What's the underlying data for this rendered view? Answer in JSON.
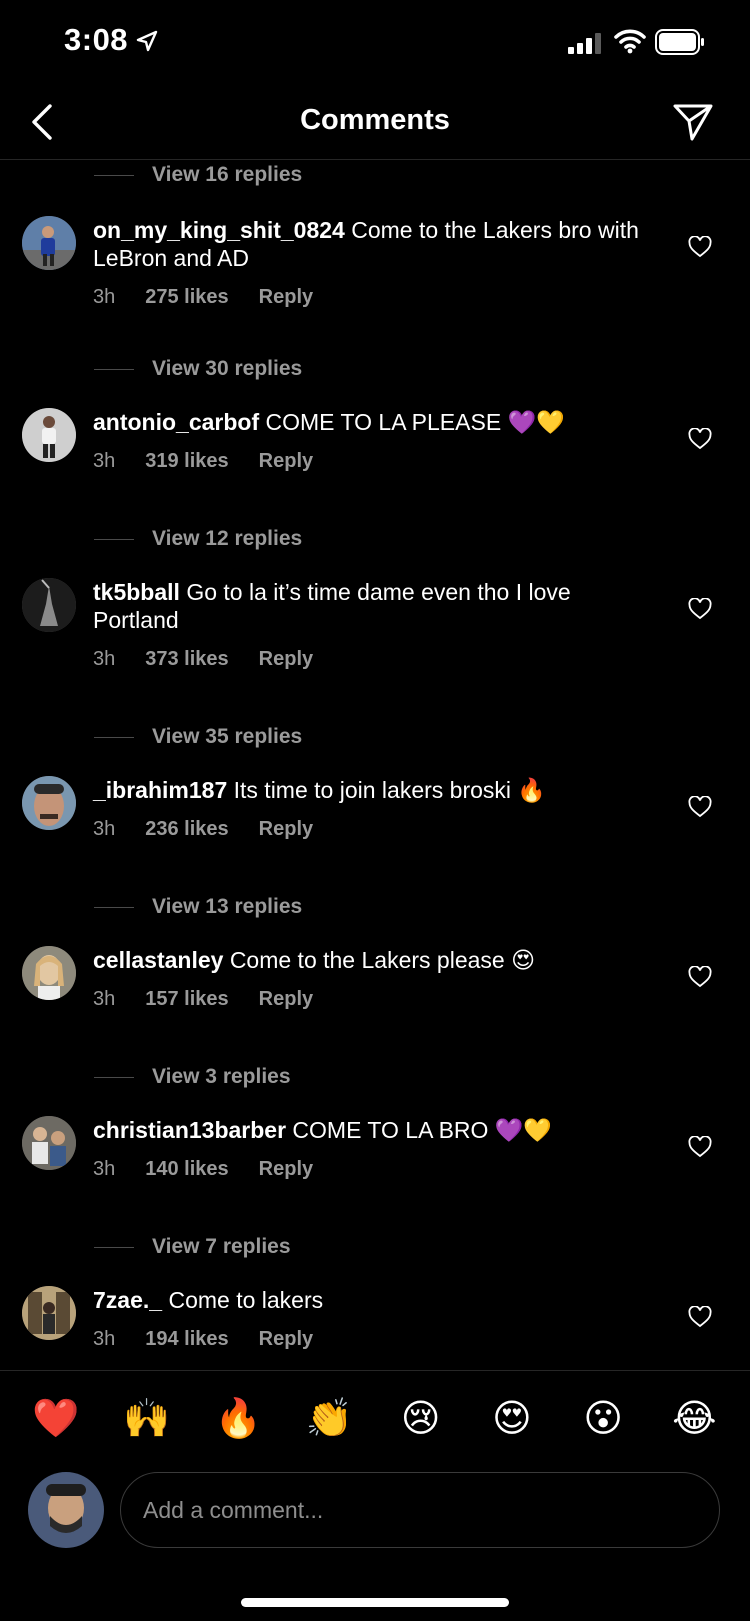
{
  "status": {
    "time": "3:08"
  },
  "header": {
    "title": "Comments"
  },
  "comments": [
    {
      "view_replies": "View 16 replies"
    },
    {
      "username": "on_my_king_shit_0824",
      "text": "Come to the Lakers bro with LeBron and AD",
      "time": "3h",
      "likes": "275 likes",
      "reply": "Reply",
      "view_replies": "View 30 replies"
    },
    {
      "username": "antonio_carbof",
      "text": "COME TO LA PLEASE 💜💛",
      "time": "3h",
      "likes": "319 likes",
      "reply": "Reply",
      "view_replies": "View 12 replies"
    },
    {
      "username": "tk5bball",
      "text": "Go to la it’s time dame even tho I love Portland",
      "time": "3h",
      "likes": "373 likes",
      "reply": "Reply",
      "view_replies": "View 35 replies"
    },
    {
      "username": "_ibrahim187",
      "text": "Its time to join lakers broski 🔥",
      "time": "3h",
      "likes": "236 likes",
      "reply": "Reply",
      "view_replies": "View 13 replies"
    },
    {
      "username": "cellastanley",
      "text": "Come to the Lakers please 😍",
      "time": "3h",
      "likes": "157 likes",
      "reply": "Reply",
      "view_replies": "View 3 replies"
    },
    {
      "username": "christian13barber",
      "text": "COME TO LA BRO 💜💛",
      "time": "3h",
      "likes": "140 likes",
      "reply": "Reply",
      "view_replies": "View 7 replies"
    },
    {
      "username": "7zae._",
      "text": "Come to lakers",
      "time": "3h",
      "likes": "194 likes",
      "reply": "Reply"
    }
  ],
  "reactions": [
    "❤️",
    "🙌",
    "🔥",
    "👏",
    "😢",
    "😍",
    "😮",
    "😂"
  ],
  "input": {
    "placeholder": "Add a comment..."
  }
}
